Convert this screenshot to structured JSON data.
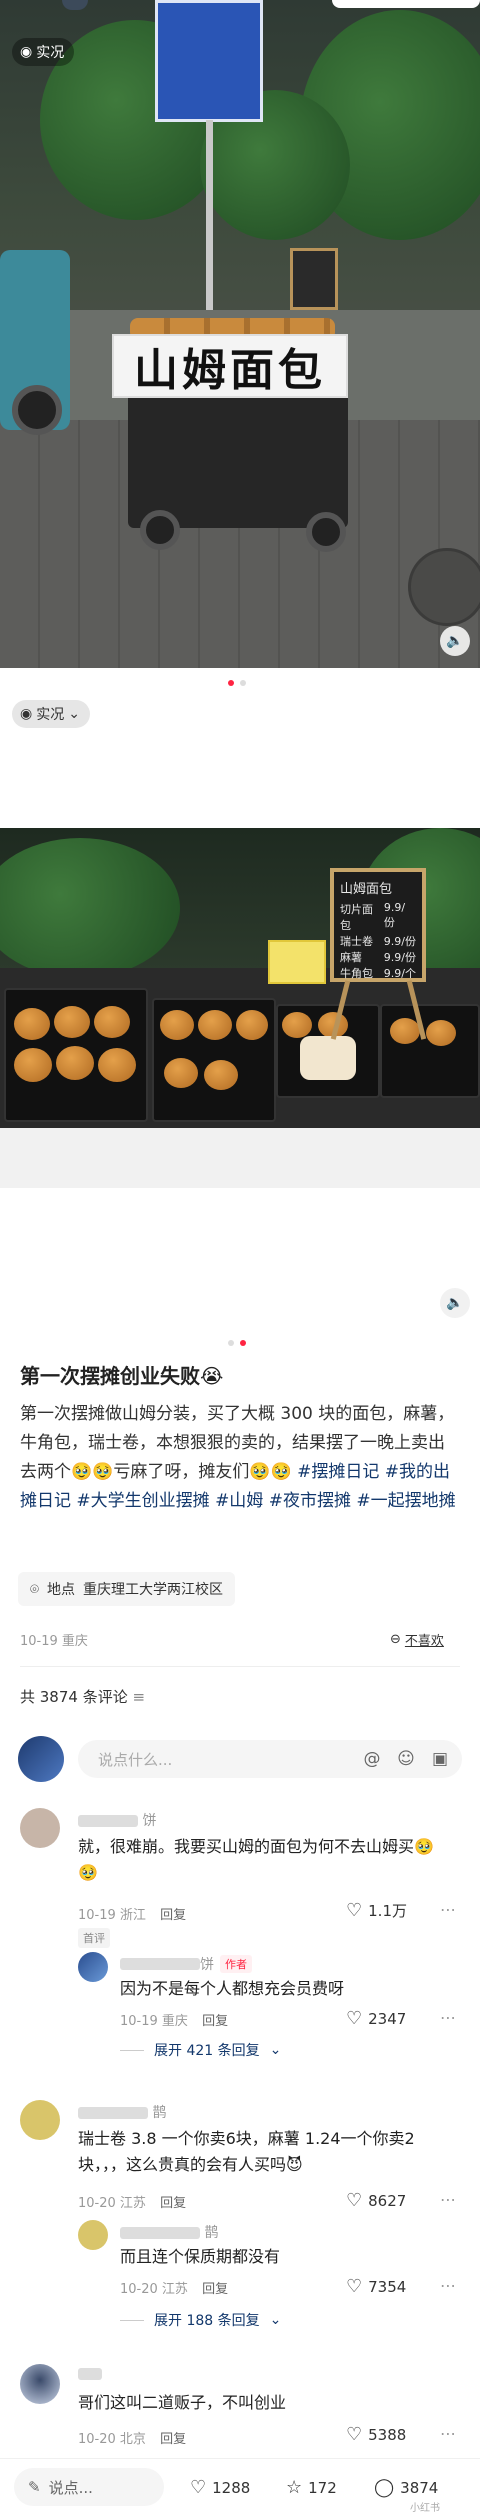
{
  "photo1": {
    "tag_label": "实况",
    "cart_sign": "山姆面包",
    "dots_active": 1
  },
  "photo2": {
    "tag_label": "实况",
    "board_title": "山姆面包",
    "board_lines": [
      "切片面包",
      "瑞士卷",
      "麻薯",
      "牛角包"
    ],
    "board_prices": [
      "9.9/份",
      "9.9/份",
      "9.9/份",
      "9.9/个"
    ]
  },
  "post": {
    "title": "第一次摆摊创业失败😭",
    "body": "第一次摆摊做山姆分装，买了大概 300 块的面包，麻薯，牛角包，瑞士卷，本想狠狠的卖的，结果摆了一晚上卖出去两个🥹🥹亏麻了呀，摊友们🥹🥹",
    "hashtags": [
      "#摆摊日记",
      "#我的出摊日记",
      "#大学生创业摆摊",
      "#山姆",
      "#夜市摆摊",
      "#一起摆地摊"
    ],
    "location_icon": "location-pin-icon",
    "location_prefix": "地点",
    "location": "重庆理工大学两江校区",
    "date": "10-19 重庆",
    "dislike": "不喜欢"
  },
  "comments_header": {
    "count_label": "共 3874 条评论"
  },
  "input": {
    "placeholder": "说点什么..."
  },
  "comments": [
    {
      "name": "饼",
      "text": "就，很难崩。我要买山姆的面包为何不去山姆买🥹🥹",
      "meta": "10-19 浙江",
      "reply": "回复",
      "likes": "1.1万",
      "badge": "首评",
      "reply_item": {
        "name": "饼",
        "author_label": "作者",
        "text": "因为不是每个人都想充会员费呀",
        "meta": "10-19 重庆",
        "reply": "回复",
        "likes": "2347"
      },
      "expand": "展开 421 条回复"
    },
    {
      "name": "鹊",
      "text": "瑞士卷 3.8 一个你卖6块，麻薯 1.24一个你卖2块，，，这么贵真的会有人买吗😈",
      "meta": "10-20 江苏",
      "reply": "回复",
      "likes": "8627",
      "reply_item": {
        "name": "鹊",
        "text": "而且连个保质期都没有",
        "meta": "10-20 江苏",
        "reply": "回复",
        "likes": "7354"
      },
      "expand": "展开 188 条回复"
    },
    {
      "name": "",
      "text": "哥们这叫二道贩子，不叫创业",
      "meta": "10-20 北京",
      "reply": "回复",
      "likes": "5388"
    }
  ],
  "bottom": {
    "say": "说点...",
    "likes": "1288",
    "stars": "172",
    "comments": "3874",
    "watermark": "小红书"
  },
  "colors": {
    "accent": "#ff2442",
    "hashtag": "#13386c"
  }
}
